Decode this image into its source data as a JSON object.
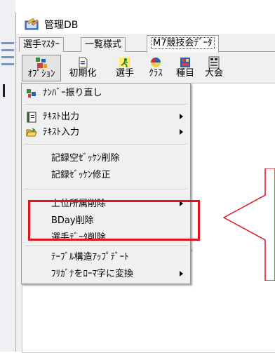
{
  "window": {
    "title": "管理DB"
  },
  "tabs": [
    {
      "label": "選手ﾏｽﾀｰ"
    },
    {
      "label": "一覧様式"
    },
    {
      "label": "M7競技会ﾃﾞｰﾀ"
    }
  ],
  "toolbar": {
    "items": [
      {
        "label": "ｵﾌﾟｼｮﾝ"
      },
      {
        "label": "初期化"
      },
      {
        "label": "選手"
      },
      {
        "label": "ｸﾗｽ"
      },
      {
        "label": "種目"
      },
      {
        "label": "大会"
      }
    ]
  },
  "menu": {
    "items": [
      {
        "label": "ﾅﾝﾊﾞｰ振り直し"
      },
      {
        "label": "ﾃｷｽﾄ出力"
      },
      {
        "label": "ﾃｷｽﾄ入力"
      },
      {
        "label": "記録空ｾﾞｯｹﾝ削除"
      },
      {
        "label": "記録ｾﾞｯｹﾝ修正"
      },
      {
        "label": "上位所属削除"
      },
      {
        "label": "BDay削除"
      },
      {
        "label": "選手ﾃﾞｰﾀ削除"
      },
      {
        "label": "ﾃｰﾌﾞﾙ構造ｱｯﾌﾟﾃﾞｰﾄ"
      },
      {
        "label": "ﾌﾘｶﾞﾅをﾛｰﾏ字に変換"
      }
    ]
  },
  "colors": {
    "highlight": "#e0141e",
    "window_bg": "#f0f0f0",
    "menu_bg": "#f0f0f0"
  }
}
